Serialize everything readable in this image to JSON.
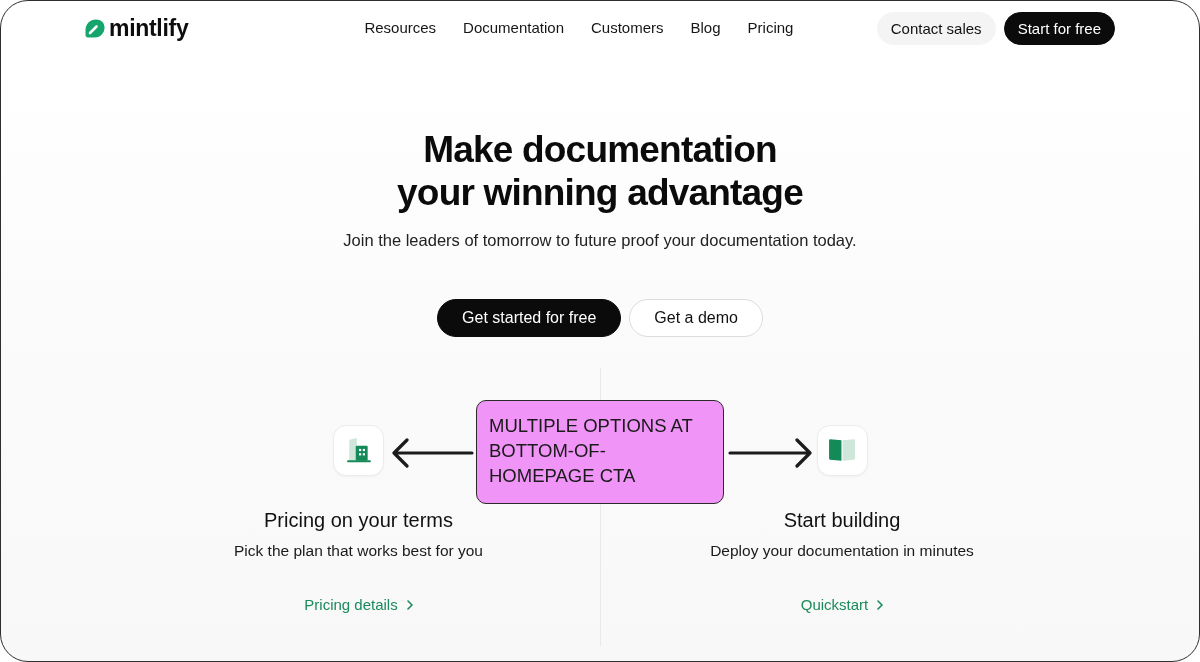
{
  "nav": {
    "brand": "mintlify",
    "links": [
      "Resources",
      "Documentation",
      "Customers",
      "Blog",
      "Pricing"
    ],
    "buttons": [
      {
        "label": "Contact sales",
        "kind": "secondary"
      },
      {
        "label": "Start for free",
        "kind": "primary"
      }
    ]
  },
  "hero": {
    "title": "Make documentation your winning advantage",
    "subtitle": "Join the leaders of tomorrow to future proof your documentation today.",
    "buttons": [
      {
        "label": "Get started for free",
        "kind": "primary"
      },
      {
        "label": "Get a demo",
        "kind": "outline"
      }
    ]
  },
  "options": [
    {
      "title": "Pricing on your terms",
      "description": "Pick the plan that works best for you",
      "link": "Pricing details"
    },
    {
      "title": "Start building",
      "description": "Deploy your documentation in minutes",
      "link": "Quickstart"
    }
  ],
  "annotation": {
    "text": "MULTIPLE OPTIONS AT BOTTOM-OF-HOMEPAGE CTA"
  }
}
